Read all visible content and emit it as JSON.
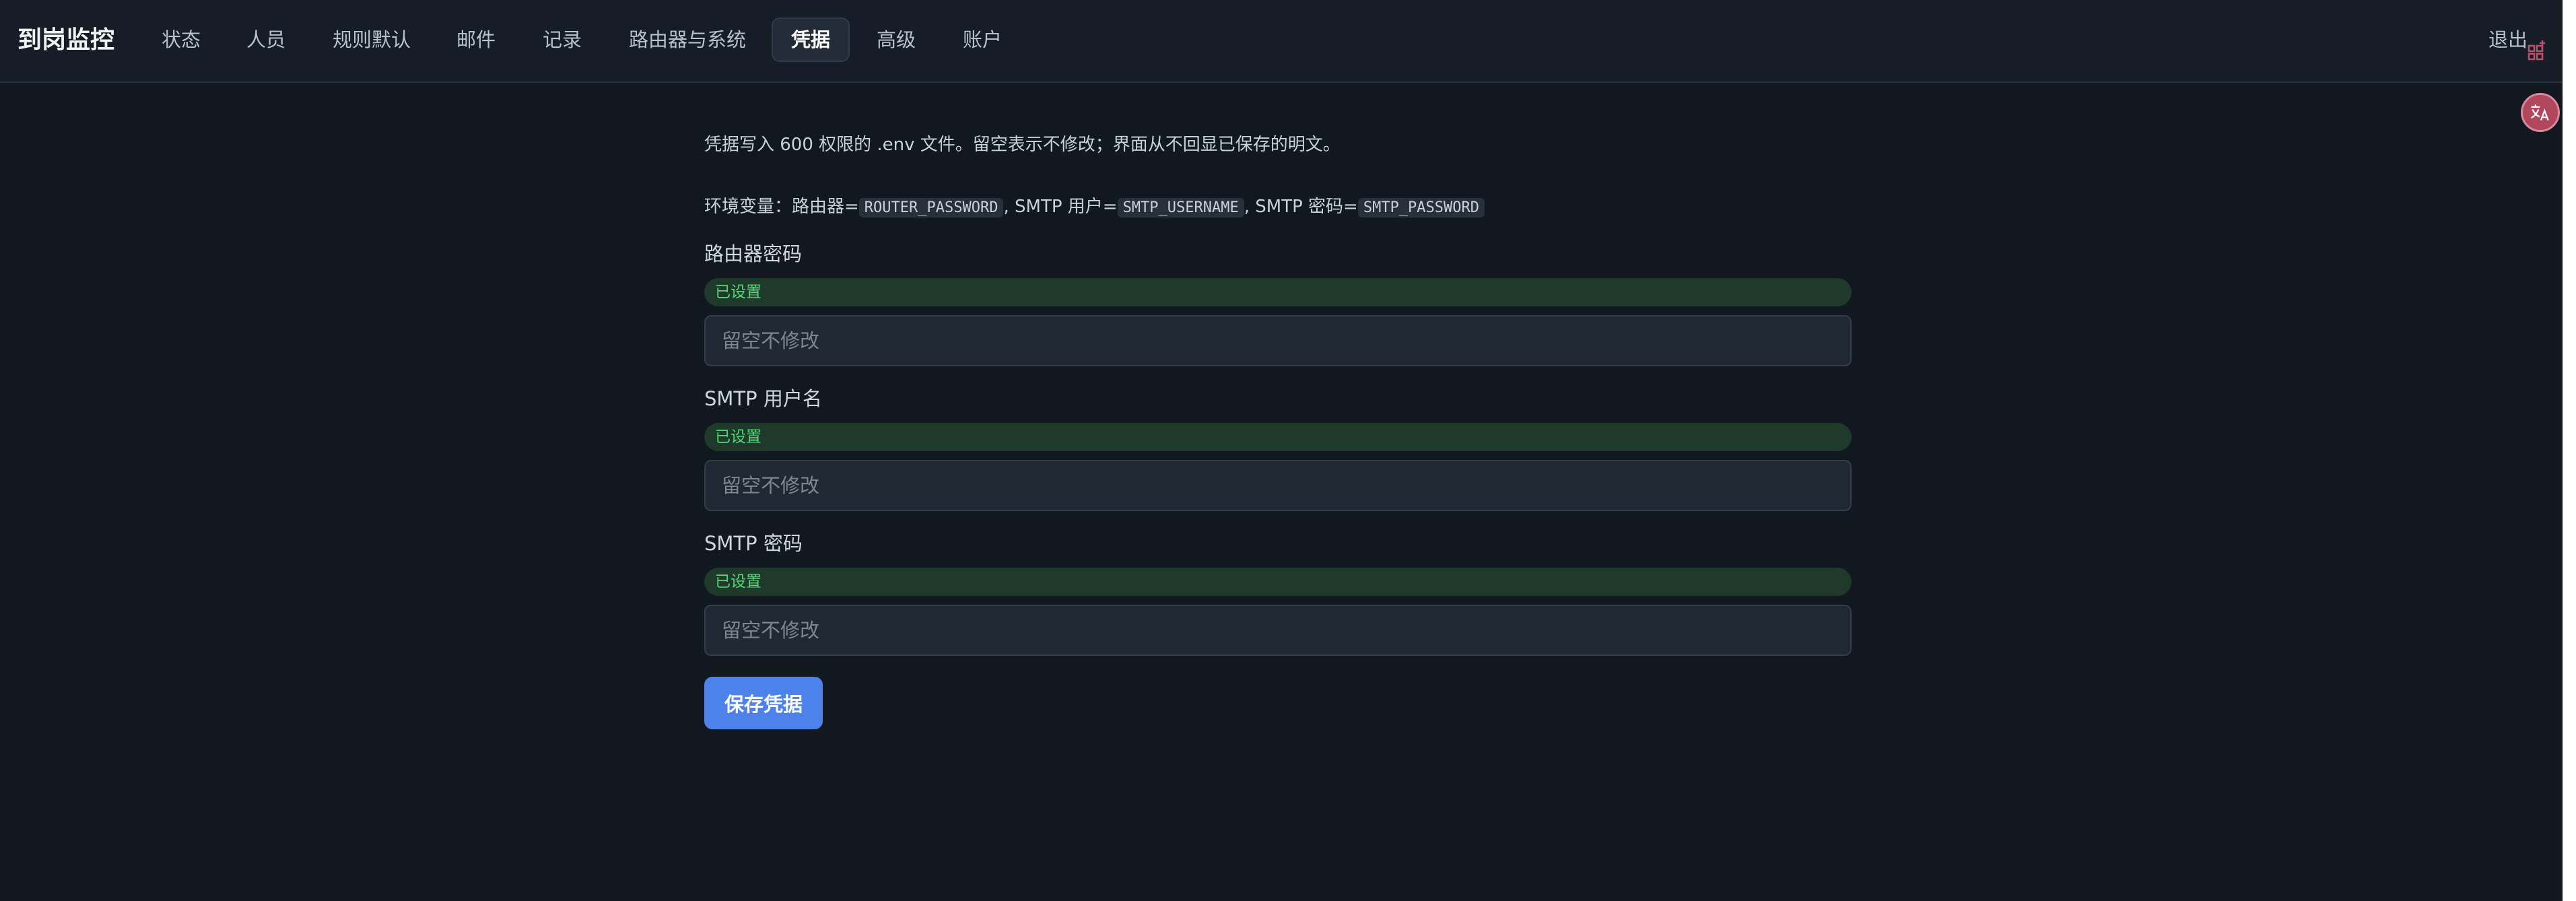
{
  "app": {
    "brand": "到岗监控"
  },
  "nav": {
    "items": [
      {
        "label": "状态",
        "active": false
      },
      {
        "label": "人员",
        "active": false
      },
      {
        "label": "规则默认",
        "active": false
      },
      {
        "label": "邮件",
        "active": false
      },
      {
        "label": "记录",
        "active": false
      },
      {
        "label": "路由器与系统",
        "active": false
      },
      {
        "label": "凭据",
        "active": true
      },
      {
        "label": "高级",
        "active": false
      },
      {
        "label": "账户",
        "active": false
      }
    ],
    "logout_label": "退出"
  },
  "credentials": {
    "intro": "凭据写入 600 权限的 .env 文件。留空表示不修改；界面从不回显已保存的明文。",
    "env": {
      "prefix": "环境变量：路由器=",
      "router_var": "ROUTER_PASSWORD",
      "sep_smtp_user": ", SMTP 用户=",
      "smtp_user_var": "SMTP_USERNAME",
      "sep_smtp_pass": ", SMTP 密码=",
      "smtp_pass_var": "SMTP_PASSWORD"
    },
    "fields": [
      {
        "label": "路由器密码",
        "status": "已设置",
        "placeholder": "留空不修改",
        "value": ""
      },
      {
        "label": "SMTP 用户名",
        "status": "已设置",
        "placeholder": "留空不修改",
        "value": ""
      },
      {
        "label": "SMTP 密码",
        "status": "已设置",
        "placeholder": "留空不修改",
        "value": ""
      }
    ],
    "save_label": "保存凭据"
  },
  "colors": {
    "background": "#111820",
    "topbar": "#161d26",
    "accent": "#4c82ea",
    "success_badge_bg": "#1f3a2a",
    "success_badge_text": "#56d67a"
  },
  "icons": {
    "extension": "grid-plus-icon",
    "translate": "translate-icon"
  }
}
